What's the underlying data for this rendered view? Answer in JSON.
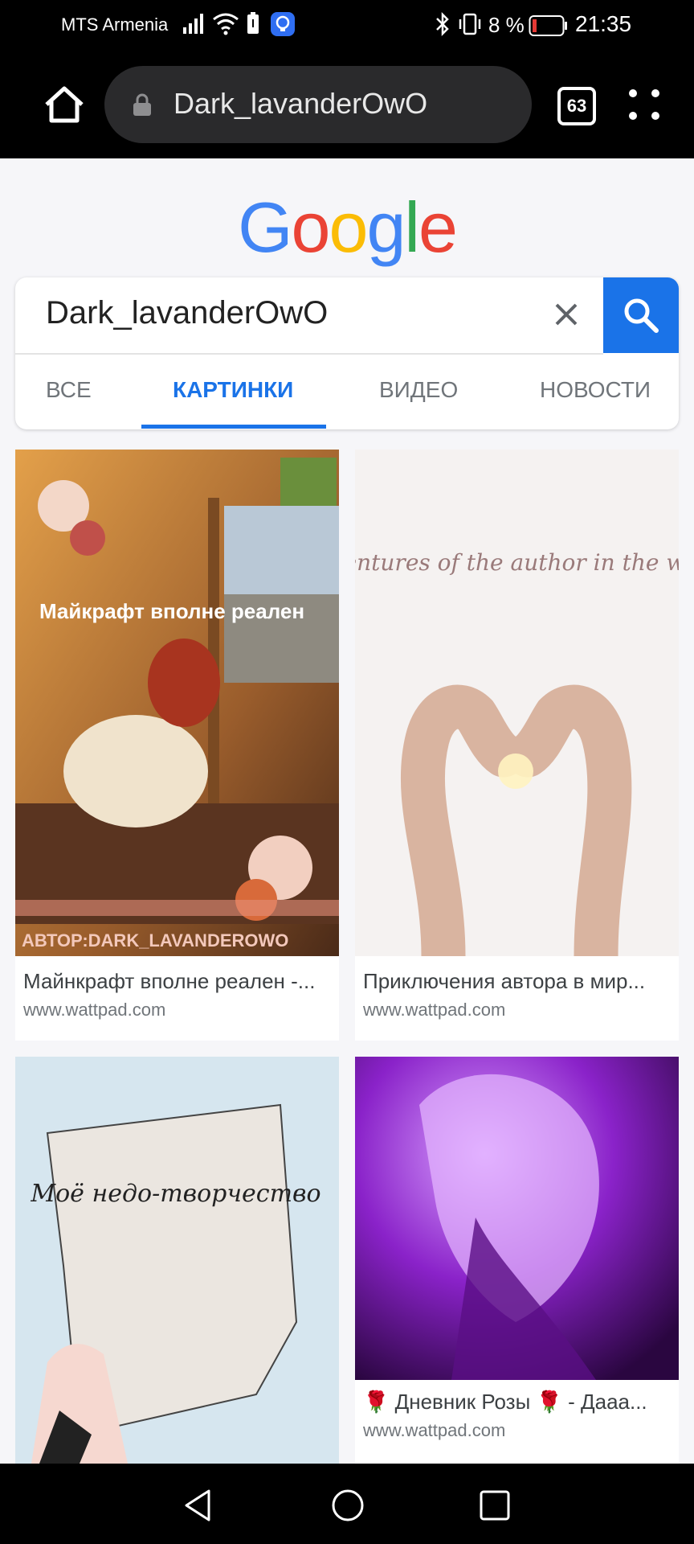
{
  "status_bar": {
    "carrier": "MTS Armenia",
    "battery_percent": "8 %",
    "time": "21:35"
  },
  "browser": {
    "url_text": "Dark_lavanderOwO",
    "tab_count": "63"
  },
  "google": {
    "logo_letters": [
      "G",
      "o",
      "o",
      "g",
      "l",
      "e"
    ],
    "logo_colors": [
      "#4285f4",
      "#ea4335",
      "#fbbc05",
      "#4285f4",
      "#34a853",
      "#ea4335"
    ]
  },
  "search": {
    "query": "Dark_lavanderOwO"
  },
  "tabs": [
    {
      "label": "ВСЕ",
      "active": false
    },
    {
      "label": "КАРТИНКИ",
      "active": true
    },
    {
      "label": "ВИДЕО",
      "active": false
    },
    {
      "label": "НОВОСТИ",
      "active": false
    }
  ],
  "results": [
    {
      "caption": "Майнкрафт вполне реален -...",
      "site": "www.wattpad.com",
      "overlay_text": "Майкрафт вполне реален",
      "footer_text": "АВТОР:DARK_LAVANDEROWO"
    },
    {
      "caption": "Приключения автора в мир...",
      "site": "www.wattpad.com",
      "overlay_text": "Adventures of the author in the world"
    },
    {
      "caption": "",
      "site": "",
      "overlay_text": "Моё недо-творчество"
    },
    {
      "caption": "🌹 Дневник Розы 🌹 - Дааа...",
      "site": "www.wattpad.com"
    }
  ],
  "colors": {
    "accent": "#1a73e8",
    "status_bar_bg": "#000000",
    "page_bg": "#f6f6f9"
  }
}
